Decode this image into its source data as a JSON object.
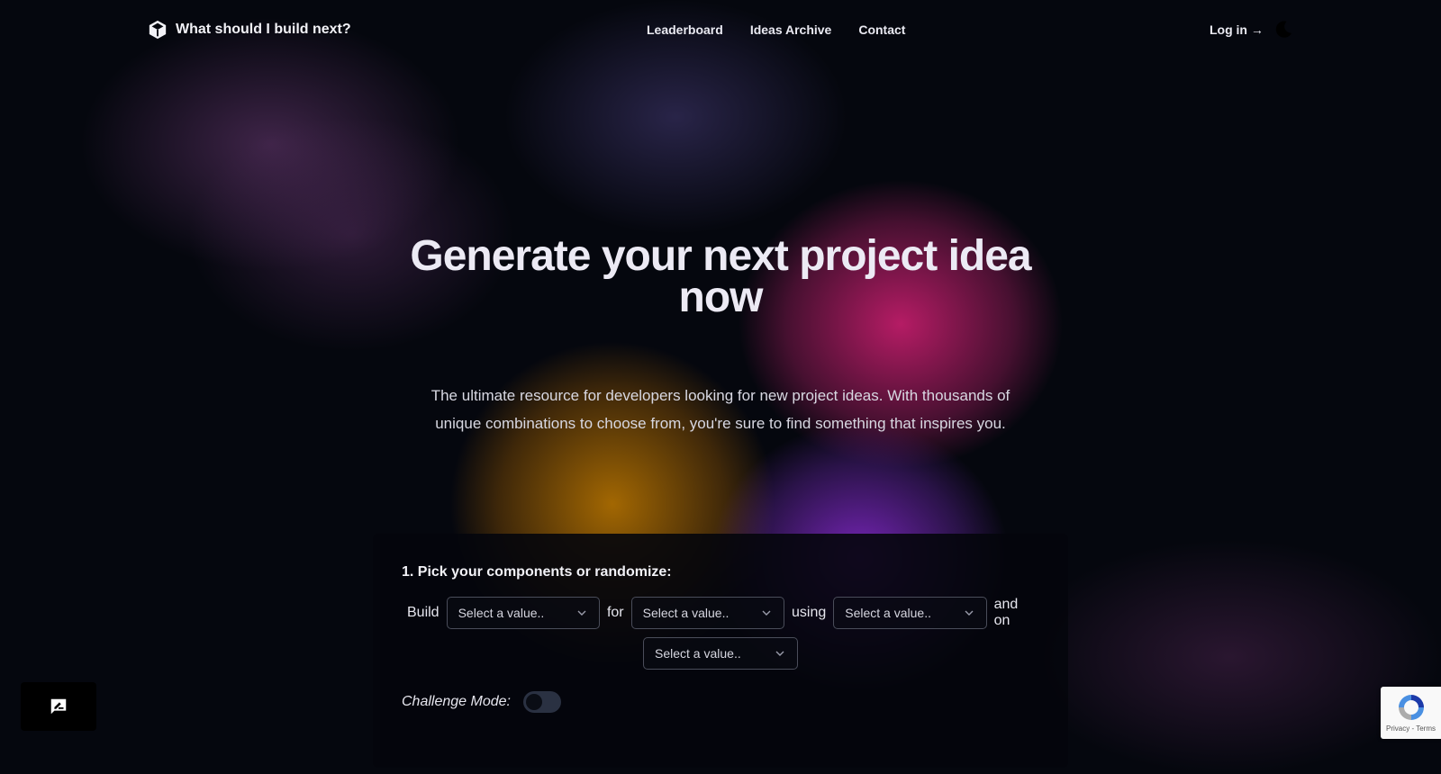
{
  "brand": {
    "name": "What should I build next?"
  },
  "nav": {
    "items": [
      "Leaderboard",
      "Ideas Archive",
      "Contact"
    ],
    "login": "Log in →"
  },
  "hero": {
    "title": "Generate your next project idea now",
    "subtitle": "The ultimate resource for developers looking for new project ideas. With thousands of unique combinations to choose from, you're sure to find something that inspires you."
  },
  "builder": {
    "step_label": "1. Pick your components or randomize:",
    "words": [
      "Build",
      "for",
      "using",
      "and on"
    ],
    "select_placeholder": "Select a value..",
    "challenge_label": "Challenge Mode:",
    "challenge_enabled": false
  },
  "recaptcha": {
    "links": "Privacy - Terms"
  },
  "colors": {
    "background": "#05070e",
    "pink_glow": "#c81e6e",
    "amber_glow": "#be7800",
    "purple_glow": "#8228c8"
  },
  "icons": {
    "brand": "cube-icon",
    "theme": "moon-icon",
    "chevron": "chevron-down-icon",
    "feedback": "feedback-icon",
    "captcha": "recaptcha-icon"
  }
}
